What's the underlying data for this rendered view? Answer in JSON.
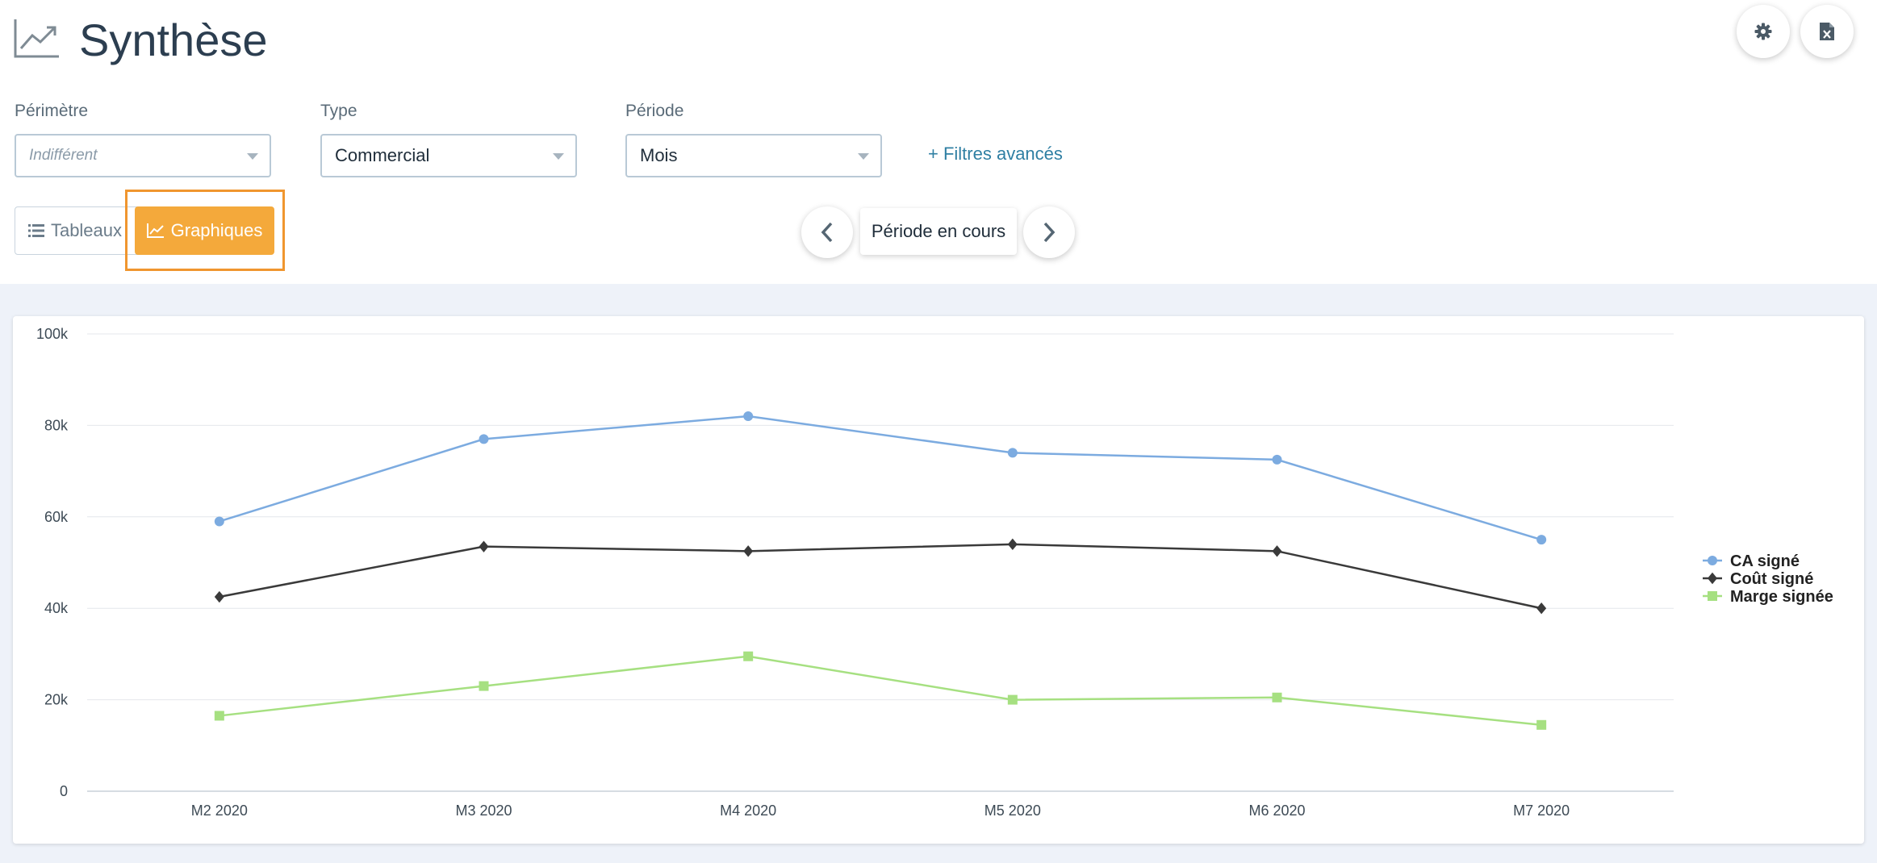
{
  "header": {
    "title": "Synthèse",
    "title_icon": "trend-chart-icon",
    "actions": [
      {
        "name": "settings-button",
        "icon": "gear-icon"
      },
      {
        "name": "export-excel-button",
        "icon": "excel-file-icon"
      }
    ]
  },
  "filters": {
    "perimetre": {
      "label": "Périmètre",
      "placeholder": "Indifférent"
    },
    "type": {
      "label": "Type",
      "value": "Commercial"
    },
    "periode": {
      "label": "Période",
      "value": "Mois"
    },
    "advanced_link": "+ Filtres avancés"
  },
  "view_toggle": {
    "tables_label": "Tableaux",
    "charts_label": "Graphiques",
    "active": "charts"
  },
  "period_nav": {
    "current_label": "Période en cours",
    "prev_icon": "chevron-left-icon",
    "next_icon": "chevron-right-icon"
  },
  "chart_data": {
    "type": "line",
    "x": [
      "M2 2020",
      "M3 2020",
      "M4 2020",
      "M5 2020",
      "M6 2020",
      "M7 2020"
    ],
    "yticks": [
      "0",
      "20k",
      "40k",
      "60k",
      "80k",
      "100k"
    ],
    "ylim": [
      0,
      100000
    ],
    "grid": true,
    "legend": "right",
    "series": [
      {
        "name": "CA signé",
        "color": "#7cabe0",
        "marker": "circle",
        "values": [
          59000,
          77000,
          82000,
          74000,
          72500,
          55000
        ]
      },
      {
        "name": "Coût signé",
        "color": "#3a3a3a",
        "marker": "diamond",
        "values": [
          42500,
          53500,
          52500,
          54000,
          52500,
          40000
        ]
      },
      {
        "name": "Marge signée",
        "color": "#a6e081",
        "marker": "square",
        "values": [
          16500,
          23000,
          29500,
          20000,
          20500,
          14500
        ]
      }
    ]
  }
}
